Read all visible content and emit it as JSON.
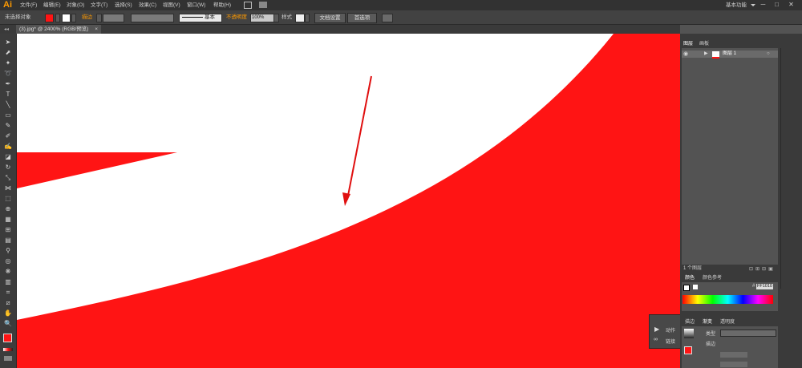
{
  "app": {
    "logo": "Ai"
  },
  "menubar": {
    "items": [
      "文件(F)",
      "编辑(E)",
      "对象(O)",
      "文字(T)",
      "选择(S)",
      "效果(C)",
      "视图(V)",
      "窗口(W)",
      "帮助(H)"
    ],
    "workspace": "基本功能",
    "window_controls": {
      "minimize": "─",
      "restore": "□",
      "close": "✕"
    }
  },
  "control_bar": {
    "selection_state": "未选择对象",
    "stroke_label": "描边",
    "brush_label": "基本",
    "opacity_label": "不透明度",
    "opacity_value": "100%",
    "style_label": "样式",
    "doc_setup_button": "文档设置",
    "preferences_button": "首选项"
  },
  "document": {
    "tab_title": "(3).jpg* @ 2400% (RGB/预览)",
    "close": "×"
  },
  "layers_panel": {
    "tabs": [
      "图层",
      "画板"
    ],
    "layer_name": "图层 1",
    "footer": "1 个图层"
  },
  "color_panel": {
    "tabs": [
      "颜色",
      "颜色参考"
    ],
    "hex_label": "#",
    "hex_value": "FF1010"
  },
  "gradient_panel": {
    "tabs": [
      "描边",
      "渐变",
      "透明度"
    ],
    "type_label": "类型",
    "stroke_label": "描边"
  },
  "actions_panel": {
    "items": [
      {
        "icon": "play-icon",
        "label": "动作"
      },
      {
        "icon": "link-icon",
        "label": "链接"
      }
    ]
  },
  "colors": {
    "shape_red": "#ff1414",
    "arrow_red": "#e01010",
    "accent_orange": "#ff9a00"
  }
}
